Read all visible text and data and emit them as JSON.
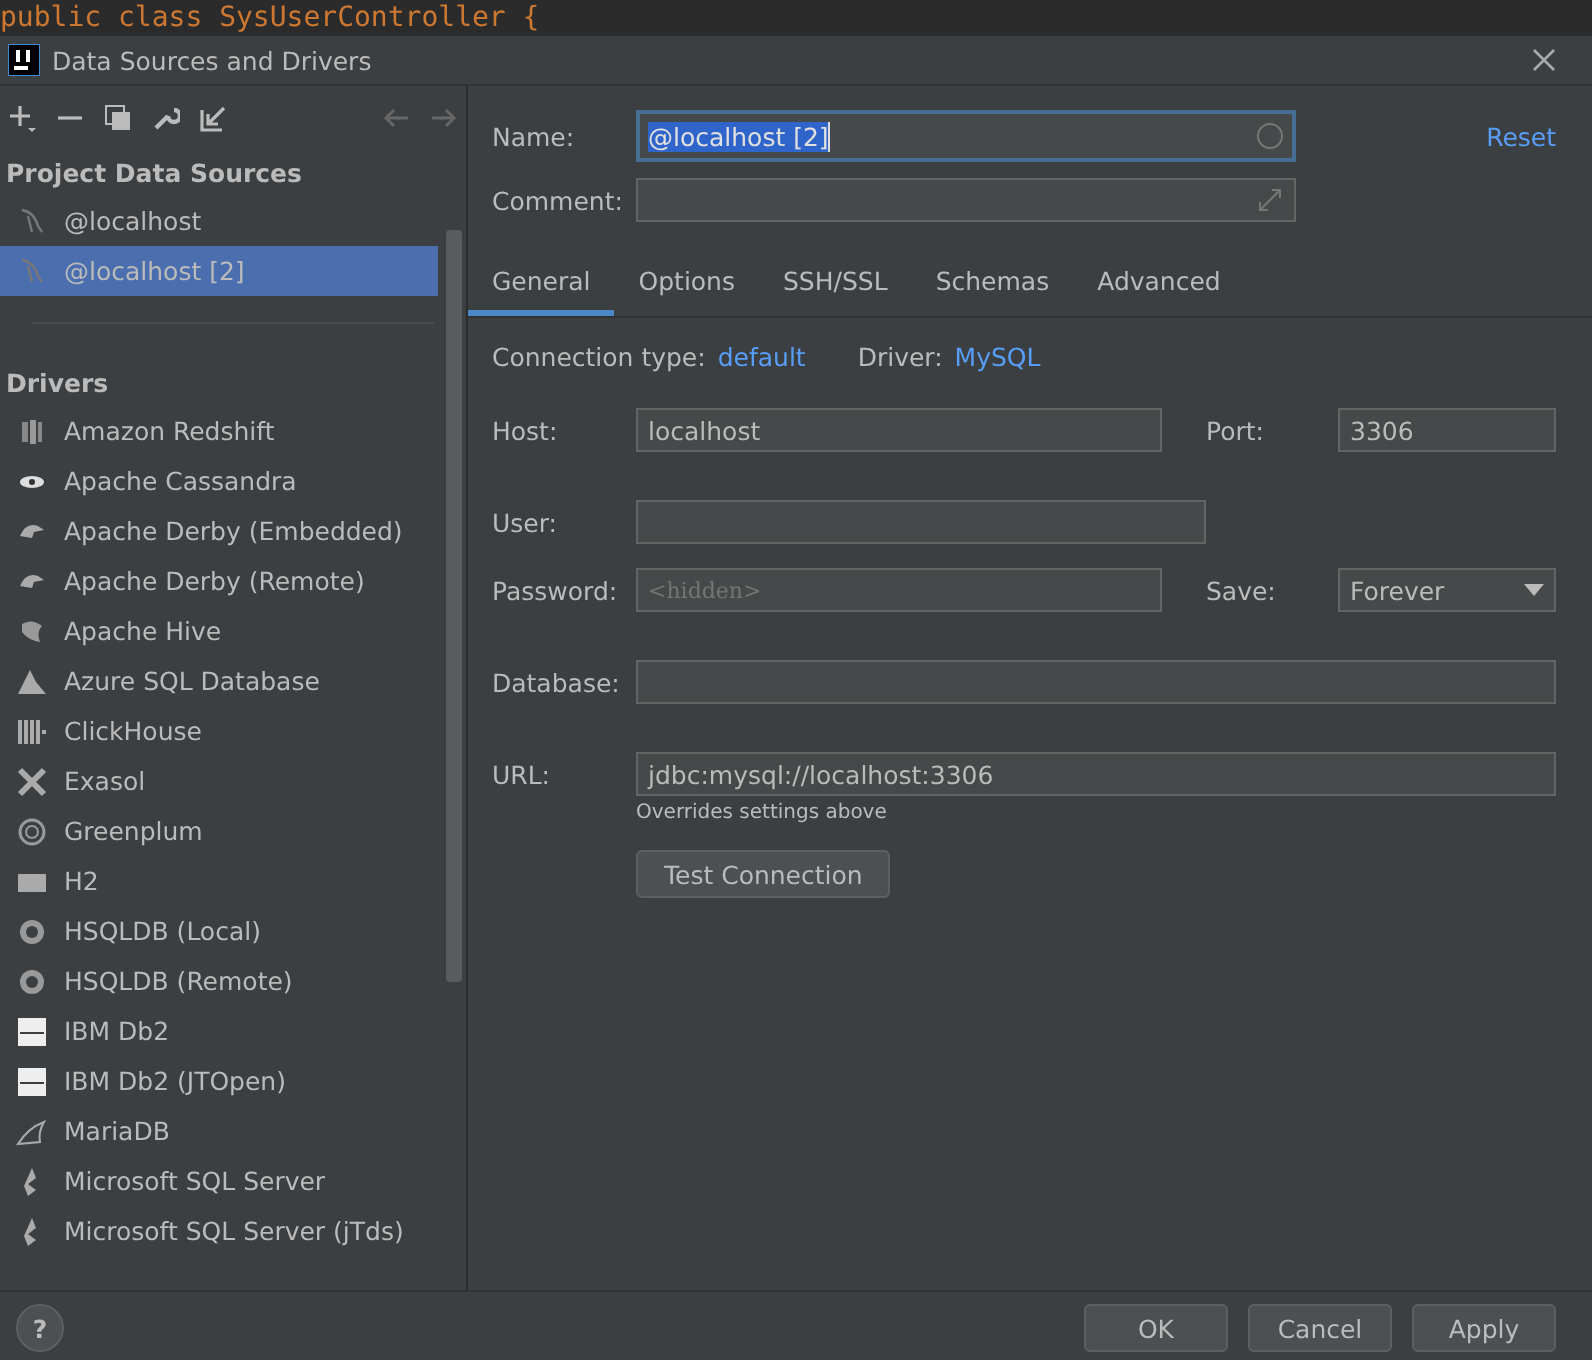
{
  "editor_behind": {
    "code": "public class SysUserController {"
  },
  "window": {
    "title": "Data Sources and Drivers"
  },
  "sidebar": {
    "project_header": "Project Data Sources",
    "sources": [
      {
        "label": "@localhost",
        "selected": false
      },
      {
        "label": "@localhost [2]",
        "selected": true
      }
    ],
    "drivers_header": "Drivers",
    "drivers": [
      "Amazon Redshift",
      "Apache Cassandra",
      "Apache Derby (Embedded)",
      "Apache Derby (Remote)",
      "Apache Hive",
      "Azure SQL Database",
      "ClickHouse",
      "Exasol",
      "Greenplum",
      "H2",
      "HSQLDB (Local)",
      "HSQLDB (Remote)",
      "IBM Db2",
      "IBM Db2 (JTOpen)",
      "MariaDB",
      "Microsoft SQL Server",
      "Microsoft SQL Server (jTds)"
    ]
  },
  "form": {
    "name_label": "Name:",
    "name_value": "@localhost [2]",
    "reset": "Reset",
    "comment_label": "Comment:"
  },
  "tabs": [
    {
      "label": "General",
      "selected": true
    },
    {
      "label": "Options",
      "selected": false
    },
    {
      "label": "SSH/SSL",
      "selected": false
    },
    {
      "label": "Schemas",
      "selected": false
    },
    {
      "label": "Advanced",
      "selected": false
    }
  ],
  "general": {
    "connection_type_label": "Connection type:",
    "connection_type": "default",
    "driver_label": "Driver:",
    "driver": "MySQL",
    "host_label": "Host:",
    "host": "localhost",
    "port_label": "Port:",
    "port": "3306",
    "user_label": "User:",
    "password_label": "Password:",
    "password_placeholder": "<hidden>",
    "save_label": "Save:",
    "save": "Forever",
    "database_label": "Database:",
    "url_label": "URL:",
    "url": "jdbc:mysql://localhost:3306",
    "url_hint": "Overrides settings above",
    "test_button": "Test Connection"
  },
  "help": "?",
  "buttons": [
    "OK",
    "Cancel",
    "Apply"
  ]
}
